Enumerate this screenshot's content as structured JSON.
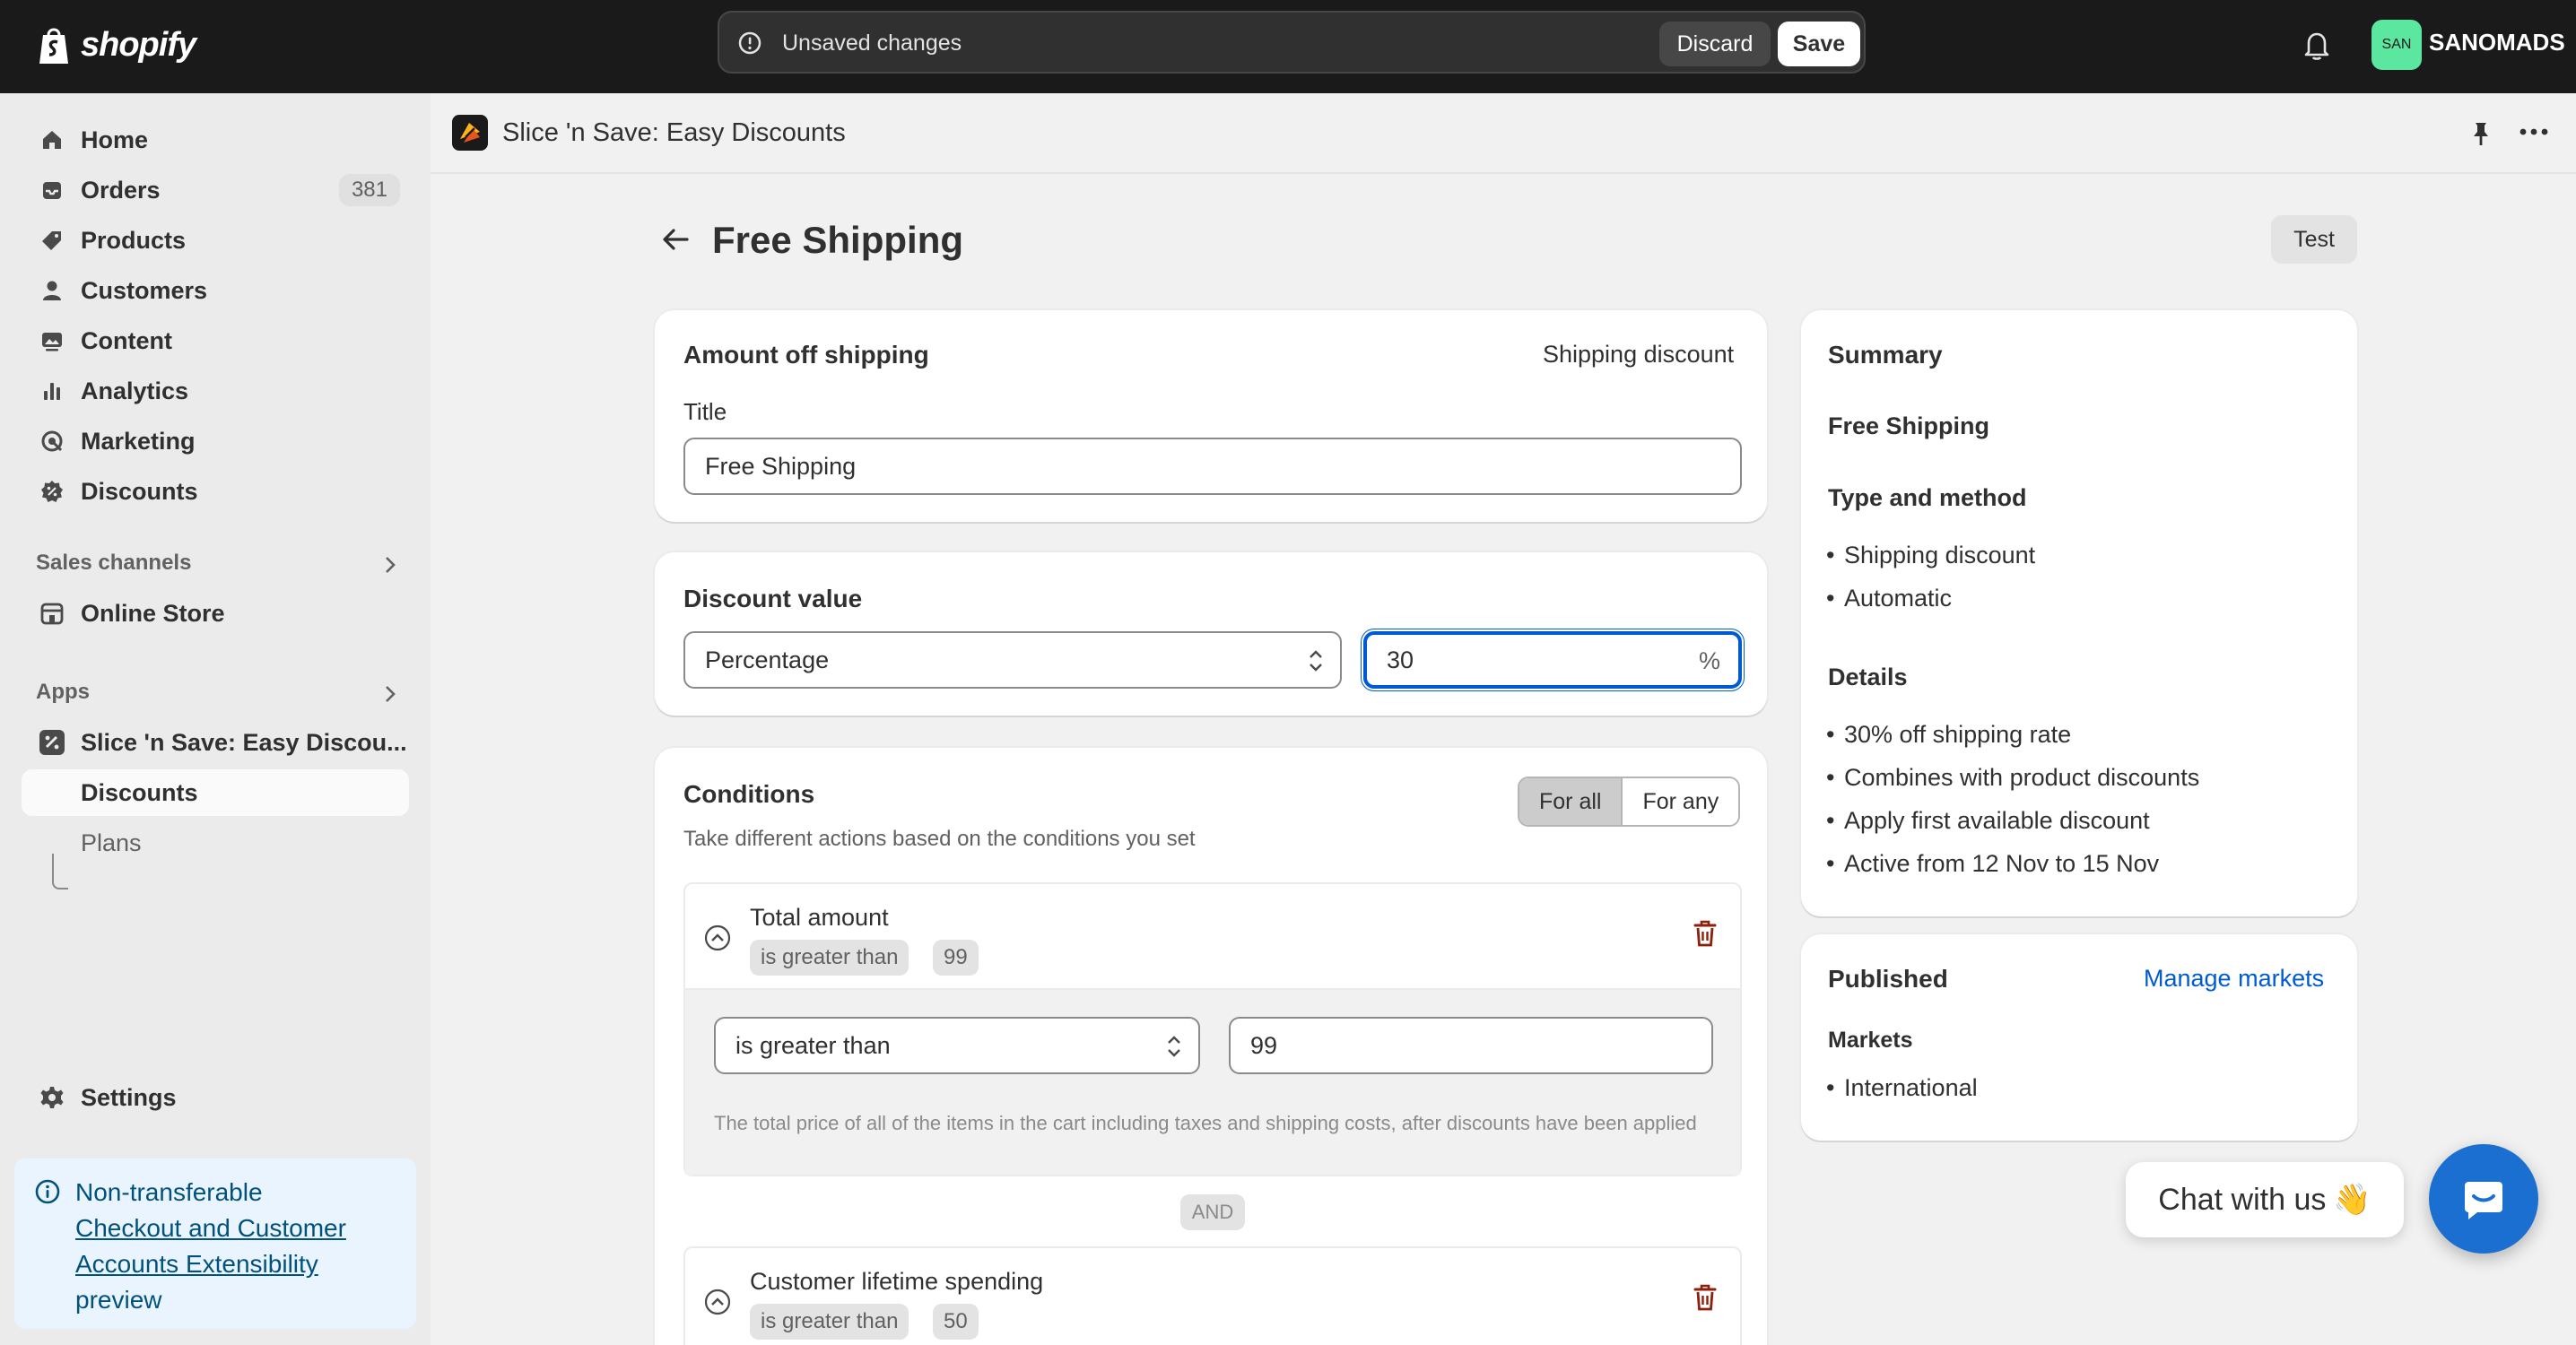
{
  "topbar": {
    "logo_text": "shopify",
    "unsaved_text": "Unsaved changes",
    "discard_label": "Discard",
    "save_label": "Save",
    "avatar_initials": "SAN",
    "store_name": "SANOMADS"
  },
  "sidebar": {
    "items": [
      {
        "label": "Home",
        "icon": "home-icon"
      },
      {
        "label": "Orders",
        "icon": "inbox-icon",
        "badge": "381"
      },
      {
        "label": "Products",
        "icon": "tag-icon"
      },
      {
        "label": "Customers",
        "icon": "person-icon"
      },
      {
        "label": "Content",
        "icon": "image-icon"
      },
      {
        "label": "Analytics",
        "icon": "bar-chart-icon"
      },
      {
        "label": "Marketing",
        "icon": "target-icon"
      },
      {
        "label": "Discounts",
        "icon": "discount-icon"
      }
    ],
    "sales_channels_title": "Sales channels",
    "online_store_label": "Online Store",
    "apps_title": "Apps",
    "app_label": "Slice 'n Save: Easy Discou...",
    "app_sub_discounts": "Discounts",
    "app_sub_plans": "Plans",
    "settings_label": "Settings",
    "info": {
      "line1": "Non-transferable",
      "link": "Checkout and Customer Accounts Extensibility",
      "line3": "preview"
    }
  },
  "app_header": {
    "title": "Slice 'n Save: Easy Discounts"
  },
  "page": {
    "title": "Free Shipping",
    "test_label": "Test"
  },
  "amount_card": {
    "title": "Amount off shipping",
    "type": "Shipping discount",
    "title_label": "Title",
    "title_value": "Free Shipping"
  },
  "discount_card": {
    "title": "Discount value",
    "type_value": "Percentage",
    "amount_value": "30",
    "suffix": "%"
  },
  "conditions_card": {
    "title": "Conditions",
    "subtitle": "Take different actions based on the conditions you set",
    "for_all": "For all",
    "for_any": "For any",
    "condition1": {
      "name": "Total amount",
      "operator": "is greater than",
      "value": "99",
      "help": "The total price of all of the items in the cart including taxes and shipping costs, after discounts have been applied"
    },
    "and_label": "AND",
    "condition2": {
      "name": "Customer lifetime spending",
      "operator": "is greater than",
      "value": "50"
    }
  },
  "summary": {
    "title": "Summary",
    "name": "Free Shipping",
    "type_title": "Type and method",
    "type_items": [
      "Shipping discount",
      "Automatic"
    ],
    "details_title": "Details",
    "details_items": [
      "30% off shipping rate",
      "Combines with product discounts",
      "Apply first available discount",
      "Active from 12 Nov to 15 Nov"
    ]
  },
  "published": {
    "title": "Published",
    "manage_label": "Manage markets",
    "markets_title": "Markets",
    "markets_items": [
      "International"
    ]
  },
  "chat": {
    "label": "Chat with us",
    "emoji": "👋"
  },
  "colors": {
    "accent": "#005bd3",
    "topbar": "#1a1a1a",
    "danger": "#8e1f0b",
    "chat": "#1b6fd1"
  }
}
